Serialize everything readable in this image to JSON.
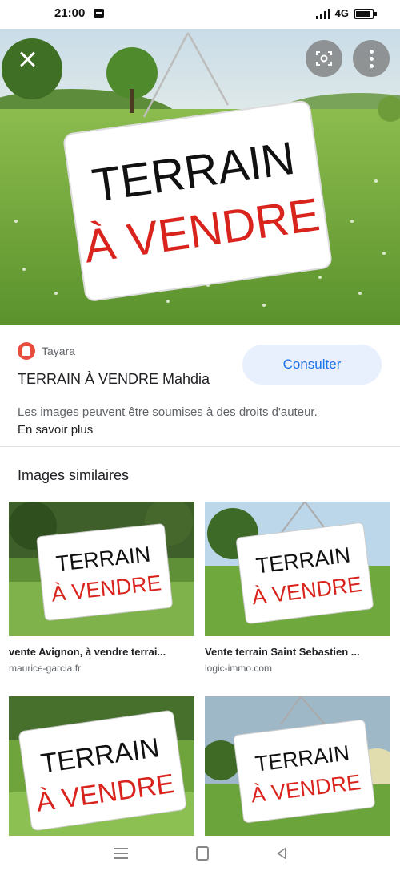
{
  "status_bar": {
    "time": "21:00",
    "network": "4G"
  },
  "viewer": {
    "close_icon": "close-icon",
    "lens_icon": "lens-icon",
    "more_icon": "more-vert-icon",
    "sign": {
      "line1": "TERRAIN",
      "line2": "À VENDRE"
    }
  },
  "result": {
    "source_name": "Tayara",
    "title": "TERRAIN À VENDRE Mahdia",
    "consult_label": "Consulter",
    "rights_text": "Les images peuvent être soumises à des droits d'auteur.",
    "learn_more": "En savoir plus"
  },
  "similar": {
    "heading": "Images similaires",
    "items": [
      {
        "title": "vente Avignon, à vendre terrai...",
        "domain": "maurice-garcia.fr",
        "sign_line1": "TERRAIN",
        "sign_line2": "À VENDRE"
      },
      {
        "title": "Vente terrain Saint Sebastien ...",
        "domain": "logic-immo.com",
        "sign_line1": "TERRAIN",
        "sign_line2": "À VENDRE"
      },
      {
        "title": "",
        "domain": "",
        "sign_line1": "TERRAIN",
        "sign_line2": "À VENDRE"
      },
      {
        "title": "",
        "domain": "",
        "sign_line1": "TERRAIN",
        "sign_line2": "À VENDRE"
      }
    ]
  },
  "colors": {
    "accent": "#1a73e8",
    "sign_red": "#d9231d",
    "grass": "#6aa03a"
  }
}
